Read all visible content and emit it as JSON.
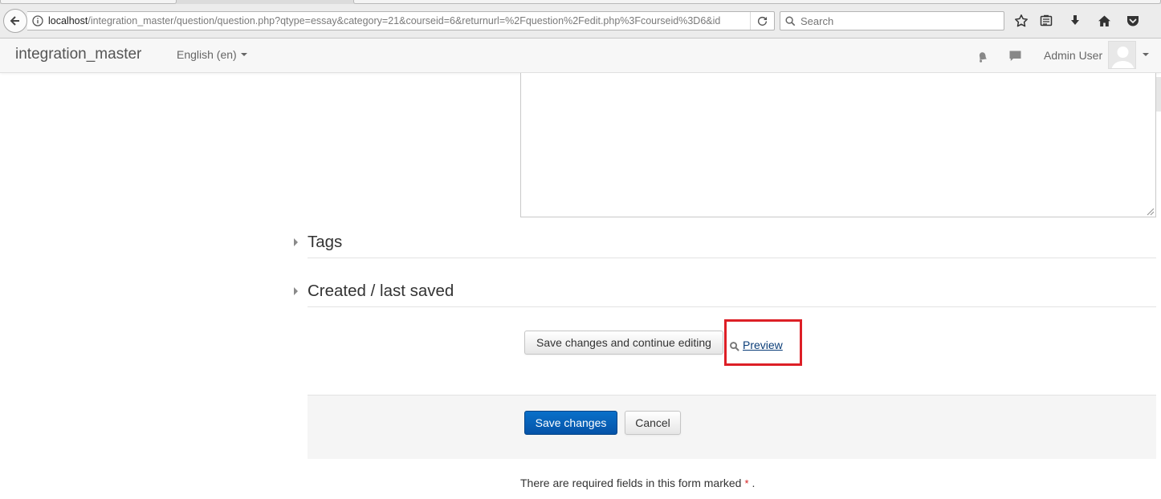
{
  "browser": {
    "url_host": "localhost",
    "url_path": "/integration_master/question/question.php?qtype=essay&category=21&courseid=6&returnurl=%2Fquestion%2Fedit.php%3Fcourseid%3D6&id",
    "search_placeholder": "Search",
    "toolbar_icons": [
      "star-icon",
      "reading-list-icon",
      "download-icon",
      "home-icon",
      "pocket-icon"
    ]
  },
  "navbar": {
    "brand": "integration_master",
    "language": "English (en)",
    "user_name": "Admin User"
  },
  "sections": {
    "tags_title": "Tags",
    "created_title": "Created / last saved"
  },
  "actions": {
    "save_continue_label": "Save changes and continue editing",
    "preview_label": "Preview",
    "save_label": "Save changes",
    "cancel_label": "Cancel"
  },
  "footer": {
    "required_text": "There are required fields in this form marked",
    "required_star": "*",
    "required_end": "."
  },
  "colors": {
    "primary_button": "#0553a8",
    "highlight_box": "#dd1f26",
    "link": "#0a3d78"
  }
}
